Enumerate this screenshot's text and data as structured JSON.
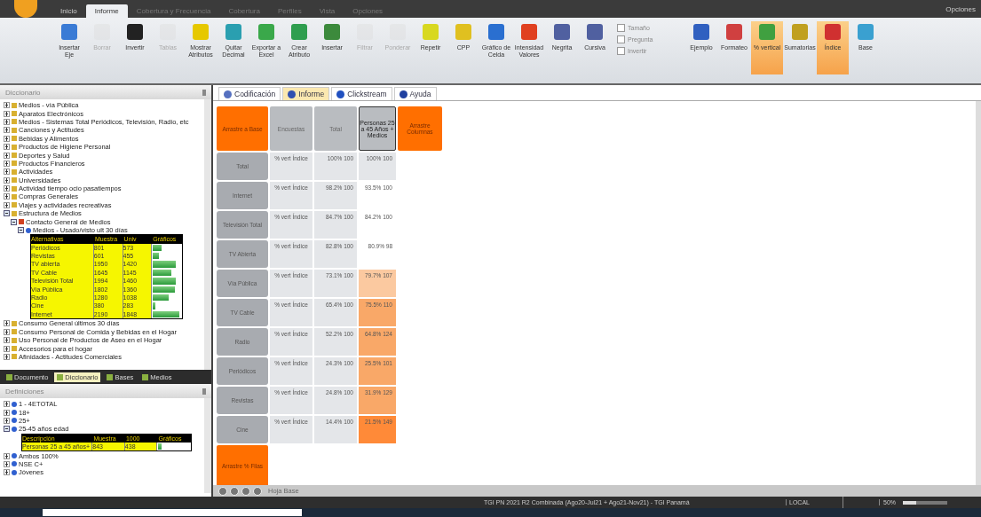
{
  "window": {
    "ribbon_tabs": [
      {
        "label": "Inicio",
        "selected": false,
        "disabled": false
      },
      {
        "label": "Informe",
        "selected": true,
        "disabled": false
      },
      {
        "label": "Cobertura y Frecuencia",
        "selected": false,
        "disabled": true
      },
      {
        "label": "Cobertura",
        "selected": false,
        "disabled": true
      },
      {
        "label": "Perfiles",
        "selected": false,
        "disabled": true
      },
      {
        "label": "Vista",
        "selected": false,
        "disabled": true
      },
      {
        "label": "Opciones",
        "selected": false,
        "disabled": true
      }
    ],
    "right_label": "Opciones"
  },
  "ribbon": {
    "buttons": [
      {
        "label": "Insertar Eje",
        "color": "#3a7bd5",
        "disabled": false,
        "highlighted": false
      },
      {
        "label": "Borrar",
        "color": "#dcdcdc",
        "disabled": true,
        "highlighted": false
      },
      {
        "label": "Invertir",
        "color": "#222222",
        "disabled": false,
        "highlighted": false
      },
      {
        "label": "Tablas",
        "color": "#dcdcdc",
        "disabled": true,
        "highlighted": false
      },
      {
        "label": "Mostrar Atributos",
        "color": "#e6c800",
        "disabled": false,
        "highlighted": false
      },
      {
        "label": "Quitar Decimal",
        "color": "#2a9fb0",
        "disabled": false,
        "highlighted": false
      },
      {
        "label": "Exportar a Excel",
        "color": "#3aa84a",
        "disabled": false,
        "highlighted": false
      },
      {
        "label": "Crear Atributo",
        "color": "#2f9e4f",
        "disabled": false,
        "highlighted": false
      },
      {
        "label": "Insertar",
        "color": "#3c8a3c",
        "disabled": false,
        "highlighted": false
      },
      {
        "label": "Filtrar",
        "color": "#dcdcdc",
        "disabled": true,
        "highlighted": false
      },
      {
        "label": "Ponderar",
        "color": "#dcdcdc",
        "disabled": true,
        "highlighted": false
      },
      {
        "label": "Repetir",
        "color": "#d8d820",
        "disabled": false,
        "highlighted": false
      },
      {
        "label": "CPP",
        "color": "#e0c020",
        "disabled": false,
        "highlighted": false
      },
      {
        "label": "Gráfico de Celda",
        "color": "#2a6fd0",
        "disabled": false,
        "highlighted": false
      },
      {
        "label": "Intensidad Valores",
        "color": "#e04020",
        "disabled": false,
        "highlighted": false
      },
      {
        "label": "Negrita",
        "color": "#5060a0",
        "disabled": false,
        "highlighted": false
      },
      {
        "label": "Cursiva",
        "color": "#5060a0",
        "disabled": false,
        "highlighted": false
      },
      {
        "label": "Ejemplo",
        "color": "#3060c0",
        "disabled": false,
        "highlighted": false
      },
      {
        "label": "Formateo",
        "color": "#d04040",
        "disabled": false,
        "highlighted": false
      },
      {
        "label": "% vertical",
        "color": "#40a040",
        "disabled": false,
        "highlighted": true
      },
      {
        "label": "Sumatorias",
        "color": "#c0a020",
        "disabled": false,
        "highlighted": false
      },
      {
        "label": "Índice",
        "color": "#d03030",
        "disabled": false,
        "highlighted": true
      },
      {
        "label": "Base",
        "color": "#3aa0d0",
        "disabled": false,
        "highlighted": false
      }
    ],
    "options": [
      {
        "label": "Tamaño",
        "checked": false
      },
      {
        "label": "Pregunta",
        "checked": false
      },
      {
        "label": "Invertir",
        "checked": false
      }
    ]
  },
  "dictionary": {
    "title": "Diccionario",
    "items": [
      {
        "label": "Medios - vía Pública",
        "expanded": false
      },
      {
        "label": "Aparatos Electrónicos",
        "expanded": false
      },
      {
        "label": "Medios - Sistemas Total Periódicos, Televisión, Radio, etc",
        "expanded": false
      },
      {
        "label": "Canciones y Actitudes",
        "expanded": false
      },
      {
        "label": "Bebidas y Alimentos",
        "expanded": false
      },
      {
        "label": "Productos de Higiene Personal",
        "expanded": false
      },
      {
        "label": "Deportes y Salud",
        "expanded": false
      },
      {
        "label": "Productos Financieros",
        "expanded": false
      },
      {
        "label": "Actividades",
        "expanded": false
      },
      {
        "label": "Universidades",
        "expanded": false
      },
      {
        "label": "Actividad tiempo ocio pasatiempos",
        "expanded": false
      },
      {
        "label": "Compras Generales",
        "expanded": false
      },
      {
        "label": "Viajes y actividades recreativas",
        "expanded": false
      },
      {
        "label": "Estructura de Medios",
        "expanded": true,
        "children": [
          {
            "label": "Contacto General de Medios",
            "expanded": true,
            "children": [
              {
                "label": "Medios - Usado/visto ult 30 días",
                "expanded": true,
                "grid": {
                  "columns": [
                    "Alternativas",
                    "Muestra",
                    "Univ",
                    "Gráficos"
                  ],
                  "rows": [
                    {
                      "cells": [
                        "Periódicos",
                        "801",
                        "573"
                      ],
                      "level": 0.3
                    },
                    {
                      "cells": [
                        "Revistas",
                        "601",
                        "455"
                      ],
                      "level": 0.2
                    },
                    {
                      "cells": [
                        "TV abierta",
                        "1950",
                        "1420"
                      ],
                      "level": 0.8
                    },
                    {
                      "cells": [
                        "TV Cable",
                        "1645",
                        "1145"
                      ],
                      "level": 0.65
                    },
                    {
                      "cells": [
                        "Televisión Total",
                        "1994",
                        "1460"
                      ],
                      "level": 0.82
                    },
                    {
                      "cells": [
                        "Vía Pública",
                        "1802",
                        "1360"
                      ],
                      "level": 0.78
                    },
                    {
                      "cells": [
                        "Radio",
                        "1280",
                        "1038"
                      ],
                      "level": 0.55
                    },
                    {
                      "cells": [
                        "Cine",
                        "380",
                        "283"
                      ],
                      "level": 0.1
                    },
                    {
                      "cells": [
                        "Internet",
                        "2190",
                        "1848"
                      ],
                      "level": 0.95
                    }
                  ]
                }
              }
            ]
          }
        ]
      },
      {
        "label": "Consumo General últimos 30 días",
        "expanded": false
      },
      {
        "label": "Consumo Personal de Comida y Bebidas en el Hogar",
        "expanded": false
      },
      {
        "label": "Uso Personal de Productos de Aseo en el Hogar",
        "expanded": false
      },
      {
        "label": "Accesorios para el hogar",
        "expanded": false
      },
      {
        "label": "Afinidades - Actitudes Comerciales",
        "expanded": false
      }
    ]
  },
  "panel_tabs": [
    {
      "label": "Documento",
      "selected": false
    },
    {
      "label": "Diccionario",
      "selected": true
    },
    {
      "label": "Bases",
      "selected": false
    },
    {
      "label": "Medios",
      "selected": false
    }
  ],
  "definitions": {
    "title": "Definiciones",
    "items": [
      {
        "label": "1 - 4ETOTAL",
        "expanded": false
      },
      {
        "label": "18+",
        "expanded": false
      },
      {
        "label": "25+",
        "expanded": false
      },
      {
        "label": "25-45 años edad",
        "expanded": true,
        "grid": {
          "columns": [
            "Descripción",
            "Muestra",
            "1000",
            "Gráficos"
          ],
          "rows": [
            {
              "cells": [
                "Personas 25 a 45 años+",
                "843",
                "438"
              ],
              "level": 0.1
            }
          ]
        }
      },
      {
        "label": "Ambos 100%",
        "expanded": false
      },
      {
        "label": "NSE C+",
        "expanded": false
      },
      {
        "label": "Jóvenes",
        "expanded": false
      }
    ]
  },
  "main_tabs": [
    {
      "label": "Codificación",
      "selected": false
    },
    {
      "label": "Informe",
      "selected": true
    },
    {
      "label": "Clickstream",
      "selected": false
    },
    {
      "label": "Ayuda",
      "selected": false
    }
  ],
  "report": {
    "corner": "Arrastre a Base",
    "columns": [
      {
        "label": "Encuestas",
        "kind": "grey"
      },
      {
        "label": "Total",
        "kind": "grey"
      },
      {
        "label": "Personas 25 a 45 Años + Medios",
        "kind": "selected"
      },
      {
        "label": "Arrastre Columnas",
        "kind": "drop"
      }
    ],
    "rows": [
      {
        "label": "Total",
        "measures": "% vert Índice",
        "total": "100% 100",
        "target": "100% 100",
        "color": "#e4e6e9"
      },
      {
        "label": "Internet",
        "measures": "% vert Índice",
        "total": "98.2% 100",
        "target": "93.5% 100",
        "color": "#ffffff"
      },
      {
        "label": "Televisión Total",
        "measures": "% vert Índice",
        "total": "84.7% 100",
        "target": "84.2% 100",
        "color": "#ffffff"
      },
      {
        "label": "TV Abierta",
        "measures": "% vert Índice",
        "total": "82.8% 100",
        "target": "80.9% 98",
        "color": "#ffffff"
      },
      {
        "label": "Vía Pública",
        "measures": "% vert Índice",
        "total": "73.1% 100",
        "target": "79.7% 107",
        "color": "#fbc9a0"
      },
      {
        "label": "TV Cable",
        "measures": "% vert Índice",
        "total": "65.4% 100",
        "target": "75.5% 110",
        "color": "#f9a868"
      },
      {
        "label": "Radio",
        "measures": "% vert Índice",
        "total": "52.2% 100",
        "target": "64.8% 124",
        "color": "#f9a868"
      },
      {
        "label": "Periódicos",
        "measures": "% vert Índice",
        "total": "24.3% 100",
        "target": "25.5% 101",
        "color": "#f9a868"
      },
      {
        "label": "Revistas",
        "measures": "% vert Índice",
        "total": "24.8% 100",
        "target": "31.9% 129",
        "color": "#f9a868"
      },
      {
        "label": "Cine",
        "measures": "% vert Índice",
        "total": "14.4% 100",
        "target": "21.5% 149",
        "color": "#ff8a38"
      }
    ],
    "drop_rows": "Arrastre % Filas"
  },
  "sheet_nav": {
    "label": "Hoja Base"
  },
  "status_bar": {
    "study": "TGI PN 2021 R2 Combinada (Ago20-Jul21 + Ago21-Nov21) - TGI Panamá",
    "mode": "LOCAL",
    "zoom": "50%",
    "zoom_slider": {
      "level": 0.3
    }
  }
}
